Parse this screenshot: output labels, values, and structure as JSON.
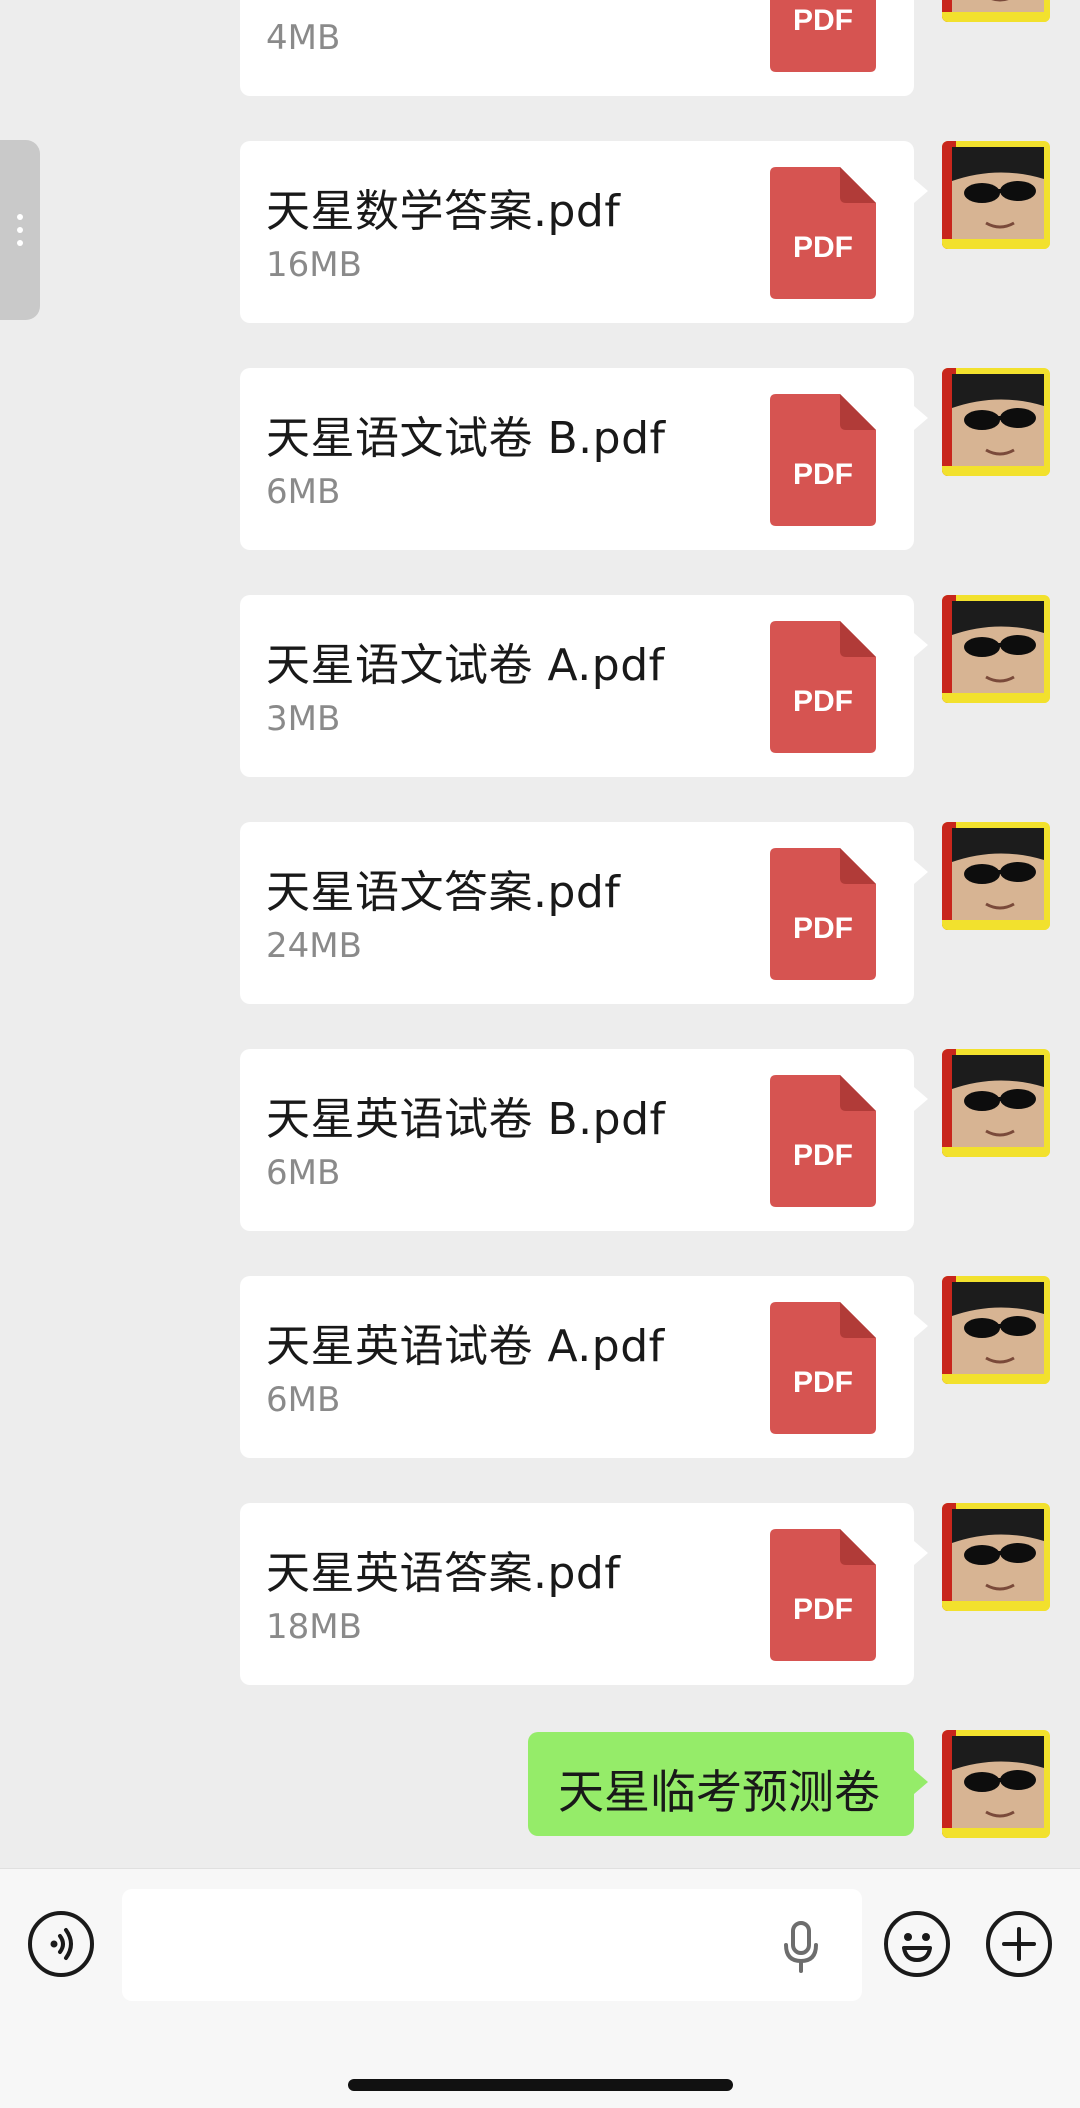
{
  "messages": [
    {
      "name": "",
      "size": "4MB",
      "tag": "PDF"
    },
    {
      "name": "天星数学答案.pdf",
      "size": "16MB",
      "tag": "PDF"
    },
    {
      "name": "天星语文试卷 B.pdf",
      "size": "6MB",
      "tag": "PDF"
    },
    {
      "name": "天星语文试卷 A.pdf",
      "size": "3MB",
      "tag": "PDF"
    },
    {
      "name": "天星语文答案.pdf",
      "size": "24MB",
      "tag": "PDF"
    },
    {
      "name": "天星英语试卷 B.pdf",
      "size": "6MB",
      "tag": "PDF"
    },
    {
      "name": "天星英语试卷 A.pdf",
      "size": "6MB",
      "tag": "PDF"
    },
    {
      "name": "天星英语答案.pdf",
      "size": "18MB",
      "tag": "PDF"
    }
  ],
  "last_text_message": "天星临考预测卷",
  "input": {
    "value": "",
    "placeholder": ""
  },
  "icons": {
    "voice": "voice-icon",
    "mic": "microphone-icon",
    "emoji": "emoji-icon",
    "add": "plus-icon"
  },
  "colors": {
    "background": "#ededed",
    "bubble_sent": "#95ec69",
    "pdf_red": "#d65451"
  }
}
